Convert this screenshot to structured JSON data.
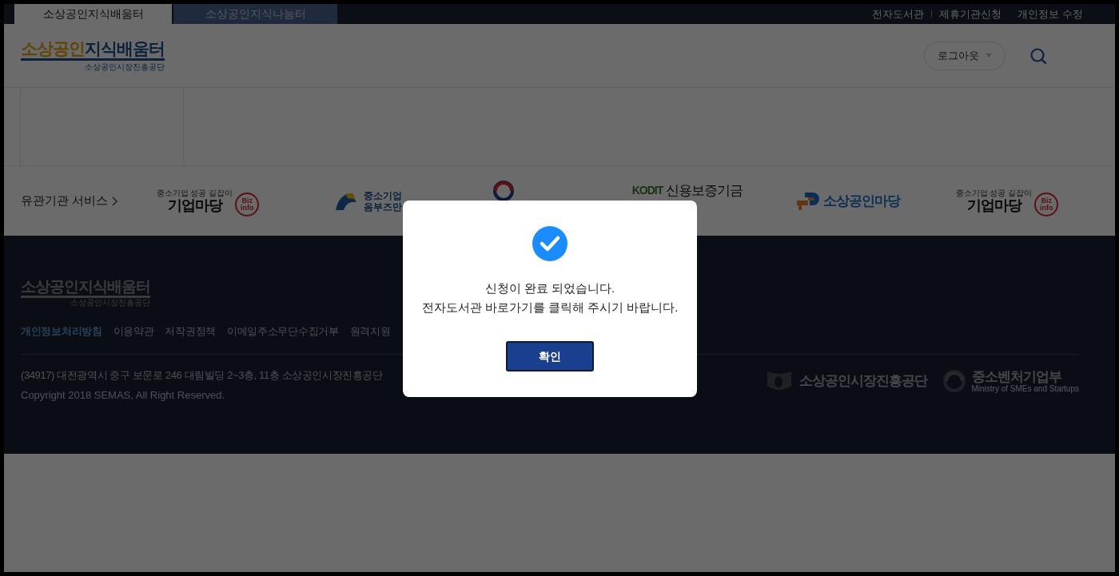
{
  "top_bar": {
    "site_tabs": [
      {
        "label": "소상공인지식배움터",
        "selected": true
      },
      {
        "label": "소상공인지식나눔터",
        "selected": false
      }
    ],
    "links": [
      "전자도서관",
      "제휴기관신청",
      "개인정보 수정"
    ]
  },
  "header": {
    "logo": {
      "part_a": "소상공인",
      "part_b": "지식배움터",
      "subtitle": "소상공인시장진흥공단"
    },
    "user_menu": "로그아웃"
  },
  "partners": {
    "heading": "유관기관 서비스",
    "logos": [
      {
        "kind": "bizinfo",
        "tagline": "중소기업 성공 길잡이",
        "name": "기업마당",
        "badge": [
          "Biz",
          "info"
        ]
      },
      {
        "kind": "ombudsman",
        "name_lines": [
          "중소기업",
          "옴부즈만"
        ]
      },
      {
        "kind": "ministry"
      },
      {
        "kind": "kodit",
        "mark": "KODIT",
        "name": "신용보증기금"
      },
      {
        "kind": "sbiz",
        "name": "소상공인마당"
      },
      {
        "kind": "bizinfo",
        "tagline": "중소기업 성공 길잡이",
        "name": "기업마당",
        "badge": [
          "Biz",
          "info"
        ]
      }
    ]
  },
  "footer": {
    "logo": {
      "title": "소상공인지식배움터",
      "subtitle": "소상공인시장진흥공단"
    },
    "links": [
      {
        "label": "개인정보처리방침",
        "highlighted": true
      },
      {
        "label": "이용약관",
        "highlighted": false
      },
      {
        "label": "저작권정책",
        "highlighted": false
      },
      {
        "label": "이메일주소무단수집거부",
        "highlighted": false
      },
      {
        "label": "원격지원",
        "highlighted": false
      }
    ],
    "address": "(34917) 대전광역시 중구 보문로 246 대림빌딩 2~3층, 11층 소상공인시장진흥공단",
    "copyright": "Copyright 2018 SEMAS, All Right Reserved.",
    "agency_logos": [
      {
        "kind": "semas",
        "name": "소상공인시장진흥공단"
      },
      {
        "kind": "mss",
        "name": "중소벤처기업부",
        "english": "Ministry of SMEs and Startups"
      }
    ]
  },
  "dialog": {
    "message_lines": [
      "신청이 완료 되었습니다.",
      "전자도서관 바로가기를 클릭해 주시기 바랍니다."
    ],
    "button": "확인"
  }
}
